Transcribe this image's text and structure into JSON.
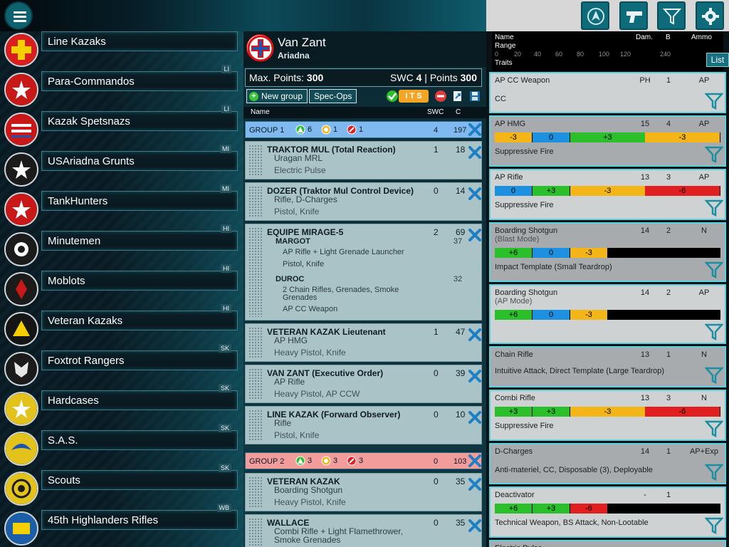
{
  "colors": {
    "green": "#2bbf2b",
    "blue": "#1e90e0",
    "yellow": "#f3b517",
    "red": "#e02020",
    "accent": "#0e6b7a"
  },
  "toolbar": {
    "menu_icon": "hamburger-menu-icon",
    "buttons": [
      {
        "name": "army-logo-button",
        "icon": "triangle-logo-icon"
      },
      {
        "name": "weapons-button",
        "icon": "pistol-icon"
      },
      {
        "name": "filter-button",
        "icon": "filter-icon"
      },
      {
        "name": "settings-button",
        "icon": "gear-icon"
      }
    ]
  },
  "factions": [
    {
      "name": "Line Kazaks",
      "tag": "",
      "color": "#d81e1e",
      "mark": "cross"
    },
    {
      "name": "Para-Commandos",
      "tag": "LI",
      "color": "#c81818",
      "mark": "star"
    },
    {
      "name": "Kazak Spetsnazs",
      "tag": "LI",
      "color": "#c81818",
      "mark": "stripes"
    },
    {
      "name": "USAriadna Grunts",
      "tag": "MI",
      "color": "#1b1b1b",
      "mark": "star"
    },
    {
      "name": "TankHunters",
      "tag": "MI",
      "color": "#c81818",
      "mark": "star"
    },
    {
      "name": "Minutemen",
      "tag": "HI",
      "color": "#1b1b1b",
      "mark": "ball"
    },
    {
      "name": "Moblots",
      "tag": "HI",
      "color": "#1b1b1b",
      "mark": "red"
    },
    {
      "name": "Veteran Kazaks",
      "tag": "HI",
      "color": "#151515",
      "mark": "tri"
    },
    {
      "name": "Foxtrot Rangers",
      "tag": "SK",
      "color": "#1b1b1b",
      "mark": "fox"
    },
    {
      "name": "Hardcases",
      "tag": "SK",
      "color": "#e3c21c",
      "mark": "star"
    },
    {
      "name": "S.A.S.",
      "tag": "SK",
      "color": "#e3c21c",
      "mark": "wing"
    },
    {
      "name": "Scouts",
      "tag": "SK",
      "color": "#e3c21c",
      "mark": "ring"
    },
    {
      "name": "45th Highlanders Rifles",
      "tag": "WB",
      "color": "#1c5fa8",
      "mark": "num"
    }
  ],
  "army": {
    "title": "Van Zant",
    "faction": "Ariadna",
    "max_points_label": "Max. Points:",
    "max_points": "300",
    "swc_label": "SWC",
    "swc": "4",
    "points_label": "Points",
    "points": "300",
    "new_group": "New group",
    "spec_ops": "Spec-Ops",
    "its_label": "I T S",
    "columns": {
      "name": "Name",
      "swc": "SWC",
      "c": "C"
    }
  },
  "groups": [
    {
      "name": "GROUP 1",
      "regular": "6",
      "irregular": "1",
      "impetuous": "1",
      "swc": "4",
      "points": "197",
      "color": "#7fb9f0"
    },
    {
      "name": "GROUP 2",
      "regular": "3",
      "irregular": "3",
      "impetuous": "3",
      "swc": "0",
      "points": "103",
      "color": "#f29c9c"
    }
  ],
  "units": [
    {
      "name": "TRAKTOR MUL (Total Reaction)",
      "w1": "Uragan MRL",
      "w2": "Electric Pulse",
      "swc": "1",
      "points": "18"
    },
    {
      "name": "DOZER (Traktor Mul Control Device)",
      "w1": "Rifle, D-Charges",
      "w2": "Pistol, Knife",
      "swc": "0",
      "points": "14"
    },
    {
      "name": "EQUIPE MIRAGE-5",
      "swc": "2",
      "points": "69",
      "subs": [
        {
          "name": "MARGOT",
          "points": "37",
          "w1": "AP Rifle + Light Grenade Launcher",
          "w2": "Pistol, Knife"
        },
        {
          "name": "DUROC",
          "points": "32",
          "w1": "2 Chain Rifles, Grenades, Smoke Grenades",
          "w2": "AP CC Weapon"
        }
      ]
    },
    {
      "name": "VETERAN KAZAK Lieutenant",
      "w1": "AP HMG",
      "w2": "Heavy Pistol, Knife",
      "swc": "1",
      "points": "47"
    },
    {
      "name": "VAN ZANT (Executive Order)",
      "w1": "AP Rifle",
      "w2": "Heavy Pistol, AP CCW",
      "swc": "0",
      "points": "39"
    },
    {
      "name": "LINE KAZAK (Forward Observer)",
      "w1": "Rifle",
      "w2": "Pistol, Knife",
      "swc": "0",
      "points": "10"
    },
    {
      "name": "VETERAN KAZAK",
      "w1": "Boarding Shotgun",
      "w2": "Heavy Pistol, Knife",
      "swc": "0",
      "points": "35"
    },
    {
      "name": "WALLACE",
      "w1": "Combi Rifle + Light Flamethrower, Smoke Grenades",
      "w2": "",
      "swc": "0",
      "points": "35"
    }
  ],
  "weapons_header": {
    "name": "Name",
    "range": "Range",
    "dam": "Dam.",
    "b": "B",
    "ammo": "Ammo",
    "traits": "Traits",
    "list": "List",
    "ticks": [
      "0",
      "20",
      "40",
      "60",
      "80",
      "100",
      "120",
      "240"
    ]
  },
  "weapons": [
    {
      "name": "AP CC Weapon",
      "mode": "",
      "dam": "PH",
      "b": "1",
      "ammo": "AP",
      "traits": "CC",
      "bands": []
    },
    {
      "name": "AP HMG",
      "mode": "",
      "dam": "15",
      "b": "4",
      "ammo": "AP",
      "traits": "Suppressive Fire",
      "bands": [
        {
          "v": "-3",
          "c": "yellow",
          "from": 0,
          "to": 8
        },
        {
          "v": "0",
          "c": "blue",
          "from": 8,
          "to": 16
        },
        {
          "v": "+3",
          "c": "green",
          "from": 16,
          "to": 32
        },
        {
          "v": "-3",
          "c": "yellow",
          "from": 32,
          "to": 48
        }
      ]
    },
    {
      "name": "AP Rifle",
      "mode": "",
      "dam": "13",
      "b": "3",
      "ammo": "AP",
      "traits": "Suppressive Fire",
      "bands": [
        {
          "v": "0",
          "c": "blue",
          "from": 0,
          "to": 8
        },
        {
          "v": "+3",
          "c": "green",
          "from": 8,
          "to": 16
        },
        {
          "v": "-3",
          "c": "yellow",
          "from": 16,
          "to": 32
        },
        {
          "v": "-6",
          "c": "red",
          "from": 32,
          "to": 48
        }
      ]
    },
    {
      "name": "Boarding Shotgun",
      "mode": "(Blast Mode)",
      "dam": "14",
      "b": "2",
      "ammo": "N",
      "traits": "Impact Template (Small Teardrop)",
      "bands": [
        {
          "v": "+6",
          "c": "green",
          "from": 0,
          "to": 8
        },
        {
          "v": "0",
          "c": "blue",
          "from": 8,
          "to": 16
        },
        {
          "v": "-3",
          "c": "yellow",
          "from": 16,
          "to": 24
        }
      ]
    },
    {
      "name": "Boarding Shotgun",
      "mode": "(AP Mode)",
      "dam": "14",
      "b": "2",
      "ammo": "AP",
      "traits": "",
      "bands": [
        {
          "v": "+6",
          "c": "green",
          "from": 0,
          "to": 8
        },
        {
          "v": "0",
          "c": "blue",
          "from": 8,
          "to": 16
        },
        {
          "v": "-3",
          "c": "yellow",
          "from": 16,
          "to": 24
        }
      ]
    },
    {
      "name": "Chain Rifle",
      "mode": "",
      "dam": "13",
      "b": "1",
      "ammo": "N",
      "traits": "Intuitive Attack, Direct Template (Large Teardrop)",
      "bands": []
    },
    {
      "name": "Combi Rifle",
      "mode": "",
      "dam": "13",
      "b": "3",
      "ammo": "N",
      "traits": "Suppressive Fire",
      "bands": [
        {
          "v": "+3",
          "c": "green",
          "from": 0,
          "to": 8
        },
        {
          "v": "+3",
          "c": "green",
          "from": 8,
          "to": 16
        },
        {
          "v": "-3",
          "c": "yellow",
          "from": 16,
          "to": 32
        },
        {
          "v": "-6",
          "c": "red",
          "from": 32,
          "to": 48
        }
      ]
    },
    {
      "name": "D-Charges",
      "mode": "",
      "dam": "14",
      "b": "1",
      "ammo": "AP+Exp",
      "traits": "Anti-materiel, CC, Disposable (3), Deployable",
      "bands": []
    },
    {
      "name": "Deactivator",
      "mode": "",
      "dam": "-",
      "b": "1",
      "ammo": "",
      "traits": "Technical Weapon, BS Attack, Non-Lootable",
      "bands": [
        {
          "v": "+6",
          "c": "green",
          "from": 0,
          "to": 8
        },
        {
          "v": "+3",
          "c": "green",
          "from": 8,
          "to": 16
        },
        {
          "v": "-6",
          "c": "red",
          "from": 16,
          "to": 24
        }
      ]
    },
    {
      "name": "Electric Pulse",
      "mode": "",
      "dam": "",
      "b": "",
      "ammo": "",
      "traits": "",
      "bands": []
    }
  ]
}
